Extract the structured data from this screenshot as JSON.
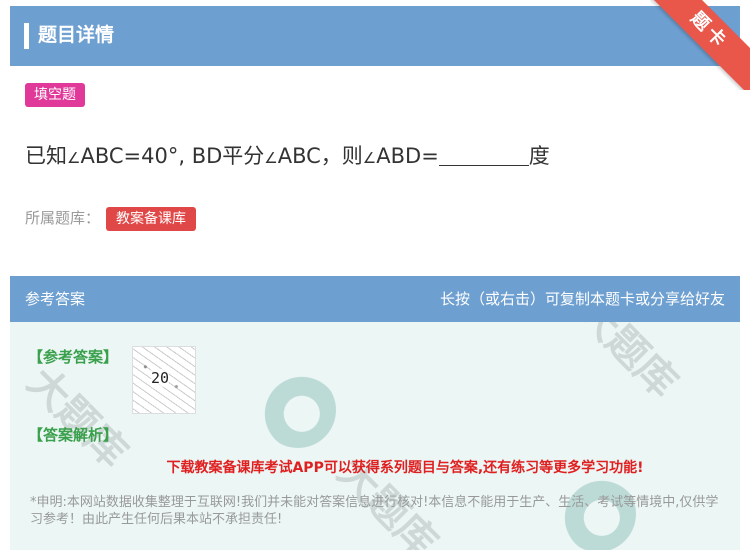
{
  "header": {
    "title": "题目详情",
    "ribbon": "题卡"
  },
  "question": {
    "type_tag": "填空题",
    "text_part1": "已知",
    "angle1": "∠",
    "text_part2": "ABC=40°, BD平分",
    "angle2": "∠",
    "text_part3": "ABC，则",
    "angle3": "∠",
    "text_part4": "ABD=",
    "text_part5": "度",
    "source_label": "所属题库：",
    "source_tag": "教案备课库"
  },
  "answer": {
    "header_left": "参考答案",
    "header_right": "长按（或右击）可复制本题卡或分享给好友",
    "answer_label": "【参考答案】",
    "answer_value": "20",
    "analysis_label": "【答案解析】",
    "promo": "下载教案备课库考试APP可以获得系列题目与答案,还有练习等更多学习功能!",
    "disclaimer": "*申明:本网站数据收集整理于互联网!我们并未能对答案信息进行核对!本信息不能用于生产、生活、考试等情境中,仅供学习参考！由此产生任何后果本站不承担责任!"
  },
  "colors": {
    "header_bg": "#6d9fd0",
    "type_tag": "#e0399a",
    "source_tag": "#e04848",
    "promo": "#e02020",
    "answer_label": "#3aa04c"
  }
}
